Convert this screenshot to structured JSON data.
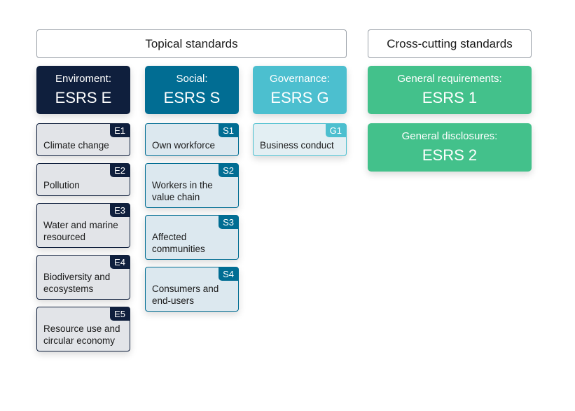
{
  "headers": {
    "topical": "Topical standards",
    "cross": "Cross-cutting standards"
  },
  "colors": {
    "environment": "#0f1f3d",
    "social": "#016d93",
    "governance": "#4cbfcf",
    "cross": "#43c18b"
  },
  "groups": {
    "e": {
      "label": "Enviroment:",
      "code": "ESRS E",
      "items": [
        {
          "tag": "E1",
          "text": "Climate change"
        },
        {
          "tag": "E2",
          "text": "Pollution"
        },
        {
          "tag": "E3",
          "text": "Water and marine resourced"
        },
        {
          "tag": "E4",
          "text": "Biodiversity and ecosystems"
        },
        {
          "tag": "E5",
          "text": "Resource use and circular economy"
        }
      ]
    },
    "s": {
      "label": "Social:",
      "code": "ESRS S",
      "items": [
        {
          "tag": "S1",
          "text": "Own workforce"
        },
        {
          "tag": "S2",
          "text": "Workers in the value chain"
        },
        {
          "tag": "S3",
          "text": "Affected communities"
        },
        {
          "tag": "S4",
          "text": "Consumers and end-users"
        }
      ]
    },
    "g": {
      "label": "Governance:",
      "code": "ESRS G",
      "items": [
        {
          "tag": "G1",
          "text": "Business conduct"
        }
      ]
    }
  },
  "cross": [
    {
      "label": "General requirements:",
      "code": "ESRS 1"
    },
    {
      "label": "General disclosures:",
      "code": "ESRS 2"
    }
  ]
}
